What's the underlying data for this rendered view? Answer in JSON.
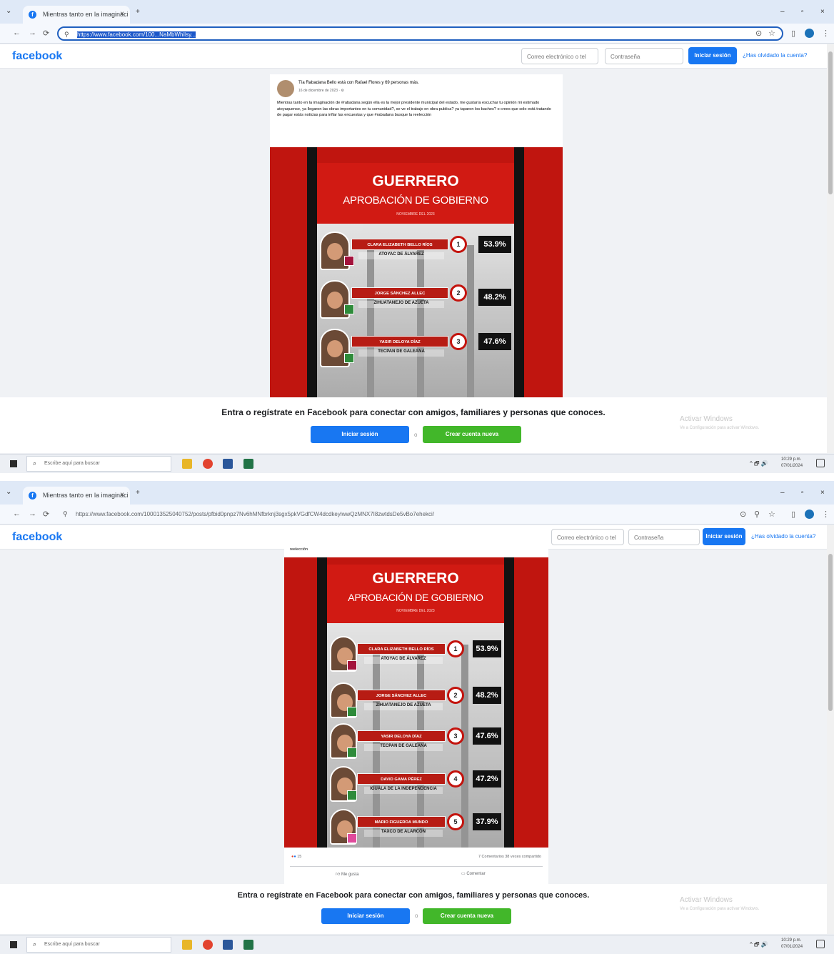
{
  "browser": {
    "tab_title": "Mientras tanto en la imaginaci",
    "tab_close": "×",
    "new_tab": "+",
    "nav": {
      "back": "←",
      "forward": "→",
      "reload": "⟳"
    },
    "url_1": "https://www.facebook.com/100...NaMbWhilsy...",
    "url_2": "https://www.facebook.com/100013525040752/posts/pfbid0pnpz7Nv6hMNfbrknj3sgx5pkVGdfCW4dcdkeyiwwQzMNX7I8zwtdsDe5vBo7ehekci/",
    "window_controls": {
      "min": "–",
      "max": "▫",
      "close": "×"
    }
  },
  "facebook": {
    "logo": "facebook",
    "email_placeholder": "Correo electrónico o tel",
    "password_placeholder": "Contraseña",
    "login_button": "Iniciar sesión",
    "forgot_link": "¿Has olvidado la cuenta?"
  },
  "post": {
    "author_line": "Tía Rabadana Bello está con Rafael Flores y 69 personas más.",
    "date": "16 de diciembre de 2023 · ⚙",
    "text": "Mientras tanto en la imaginación de #rabadana según ella es la mejor presidente municipal del estado, me gustaría escuchar tu opinión mi estimado atoyaquense, ya llegaron las obras importantes en tu comunidad?, se ve el trabajo en obra publica? ya taparon los baches? o crees que solo está tratando de pagar estás noticias para inflar las encuestas y que #rabadana busque la reelección",
    "text_end": "reelección",
    "reactions_count": "15",
    "comments_shares": "7 Comentarios  38 veces compartido",
    "like_label": "Me gusta",
    "comment_label": "Comentar"
  },
  "infographic": {
    "title": "GUERRERO",
    "subtitle": "APROBACIÓN DE GOBIERNO",
    "date": "NOVIEMBRE DEL 2023",
    "entries": [
      {
        "rank": "1",
        "name": "CLARA ELIZABETH BELLO RÍOS",
        "city": "ATOYAC DE ÁLVAREZ",
        "pct": "53.9%",
        "party_color": "#a3123b"
      },
      {
        "rank": "2",
        "name": "JORGE SÁNCHEZ ALLEC",
        "city": "ZIHUATANEJO DE AZUETA",
        "pct": "48.2%",
        "party_color": "#2e8b3a"
      },
      {
        "rank": "3",
        "name": "YASIR DELOYA DÍAZ",
        "city": "TECPAN DE GALEANA",
        "pct": "47.6%",
        "party_color": "#2e8b3a"
      },
      {
        "rank": "4",
        "name": "DAVID GAMA PÉREZ",
        "city": "IGUALA DE LA INDEPENDENCIA",
        "pct": "47.2%",
        "party_color": "#2e8b3a"
      },
      {
        "rank": "5",
        "name": "MARIO FIGUEROA MUNDO",
        "city": "TAXCO DE ALARCÓN",
        "pct": "37.9%",
        "party_color": "#e04a9b"
      }
    ]
  },
  "login_prompt": {
    "text": "Entra o regístrate en Facebook para conectar con amigos, familiares y personas que conoces.",
    "login": "Iniciar sesión",
    "separator": "o",
    "create": "Crear cuenta nueva"
  },
  "watermark": {
    "title": "Activar Windows",
    "sub": "Ve a Configuración para activar Windows."
  },
  "taskbar": {
    "search_placeholder": "Escribe aquí para buscar",
    "tray_icons": "^ 🗗 🔊",
    "time": "10:29 p.m.",
    "date": "07/01/2024"
  }
}
